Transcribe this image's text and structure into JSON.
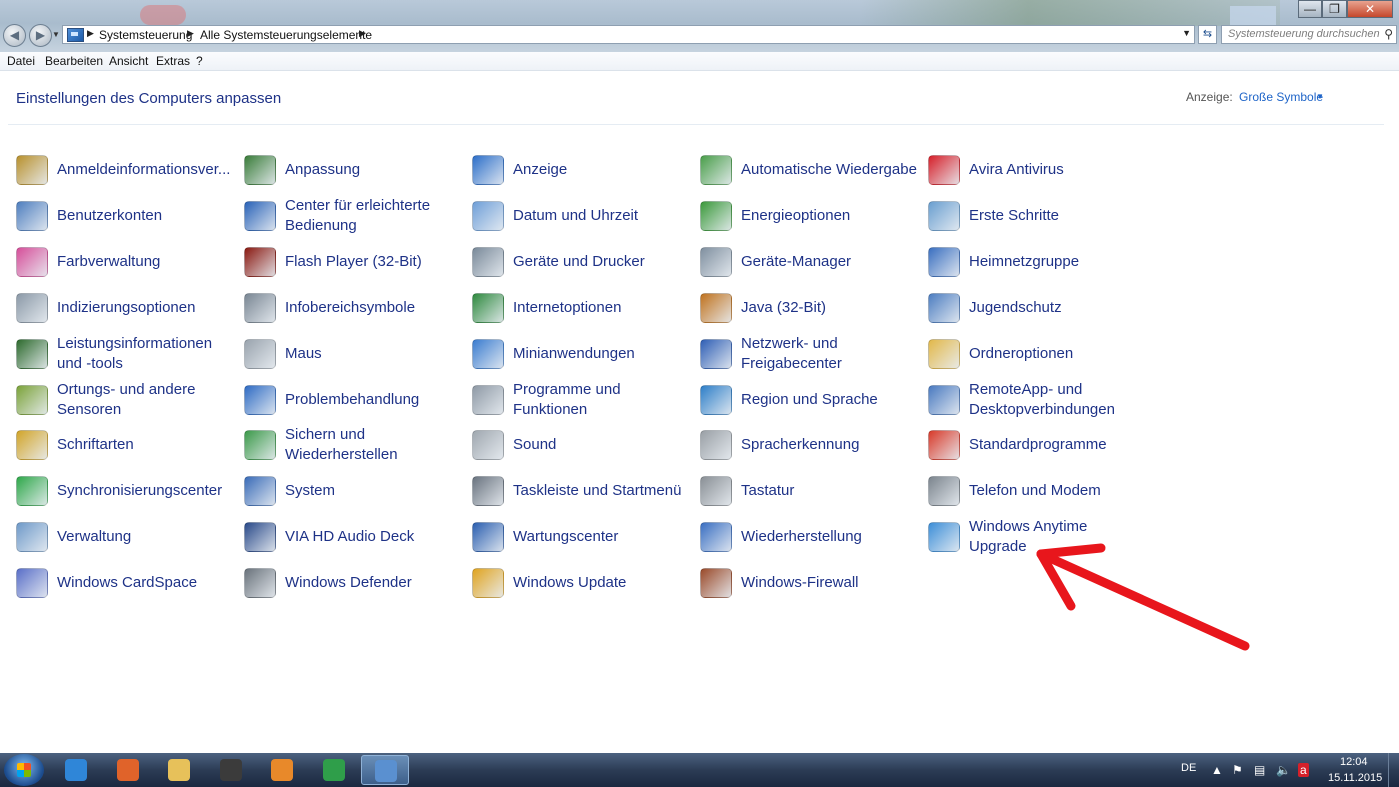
{
  "window": {
    "breadcrumb": [
      "Systemsteuerung",
      "Alle Systemsteuerungselemente"
    ],
    "search_placeholder": "Systemsteuerung durchsuchen",
    "close_color": "#c5472c"
  },
  "menubar": [
    "Datei",
    "Bearbeiten",
    "Ansicht",
    "Extras",
    "?"
  ],
  "content": {
    "title": "Einstellungen des Computers anpassen",
    "view_label": "Anzeige:",
    "view_value": "Große Symbole"
  },
  "items": [
    {
      "label": "Anmeldeinformationsver...",
      "icon": "credential-vault-icon",
      "color": "#b8912e"
    },
    {
      "label": "Anpassung",
      "icon": "personalization-icon",
      "color": "#3a7d3a"
    },
    {
      "label": "Anzeige",
      "icon": "display-icon",
      "color": "#2d6fc9"
    },
    {
      "label": "Automatische Wiedergabe",
      "icon": "autoplay-icon",
      "color": "#4a9e4a"
    },
    {
      "label": "Avira Antivirus",
      "icon": "avira-icon",
      "color": "#d6202a"
    },
    {
      "label": "Benutzerkonten",
      "icon": "user-accounts-icon",
      "color": "#4f7fbf"
    },
    {
      "label": "Center für erleichterte Bedienung",
      "icon": "ease-of-access-icon",
      "color": "#2a63b8"
    },
    {
      "label": "Datum und Uhrzeit",
      "icon": "date-time-icon",
      "color": "#6f9fd8"
    },
    {
      "label": "Energieoptionen",
      "icon": "power-options-icon",
      "color": "#3c9a3c"
    },
    {
      "label": "Erste Schritte",
      "icon": "getting-started-icon",
      "color": "#6a9fd0"
    },
    {
      "label": "Farbverwaltung",
      "icon": "color-management-icon",
      "color": "#d64f9a"
    },
    {
      "label": "Flash Player (32-Bit)",
      "icon": "flash-player-icon",
      "color": "#8a1a12"
    },
    {
      "label": "Geräte und Drucker",
      "icon": "devices-printers-icon",
      "color": "#7a8a9a"
    },
    {
      "label": "Geräte-Manager",
      "icon": "device-manager-icon",
      "color": "#8090a0"
    },
    {
      "label": "Heimnetzgruppe",
      "icon": "homegroup-icon",
      "color": "#3a6fc0"
    },
    {
      "label": "Indizierungsoptionen",
      "icon": "indexing-options-icon",
      "color": "#8c9aa8"
    },
    {
      "label": "Infobereichsymbole",
      "icon": "notification-icons-icon",
      "color": "#7a8794"
    },
    {
      "label": "Internetoptionen",
      "icon": "internet-options-icon",
      "color": "#2f8a3f"
    },
    {
      "label": "Java (32-Bit)",
      "icon": "java-icon",
      "color": "#c0731f"
    },
    {
      "label": "Jugendschutz",
      "icon": "parental-controls-icon",
      "color": "#4d7ec1"
    },
    {
      "label": "Leistungsinformationen und -tools",
      "icon": "performance-icon",
      "color": "#2e6b2e"
    },
    {
      "label": "Maus",
      "icon": "mouse-icon",
      "color": "#9aa4ae"
    },
    {
      "label": "Minianwendungen",
      "icon": "gadgets-icon",
      "color": "#3b7dd0"
    },
    {
      "label": "Netzwerk- und Freigabecenter",
      "icon": "network-sharing-icon",
      "color": "#2f5fb5"
    },
    {
      "label": "Ordneroptionen",
      "icon": "folder-options-icon",
      "color": "#e2b84a"
    },
    {
      "label": "Ortungs- und andere Sensoren",
      "icon": "sensors-icon",
      "color": "#7ca33a"
    },
    {
      "label": "Problembehandlung",
      "icon": "troubleshooting-icon",
      "color": "#2f6cc4"
    },
    {
      "label": "Programme und Funktionen",
      "icon": "programs-features-icon",
      "color": "#8f9aa6"
    },
    {
      "label": "Region und Sprache",
      "icon": "region-language-icon",
      "color": "#2e7fc8"
    },
    {
      "label": "RemoteApp- und Desktopverbindungen",
      "icon": "remoteapp-icon",
      "color": "#4a7ac0"
    },
    {
      "label": "Schriftarten",
      "icon": "fonts-icon",
      "color": "#d2a52a"
    },
    {
      "label": "Sichern und Wiederherstellen",
      "icon": "backup-restore-icon",
      "color": "#3c9a4a"
    },
    {
      "label": "Sound",
      "icon": "sound-icon",
      "color": "#a0a8b0"
    },
    {
      "label": "Spracherkennung",
      "icon": "speech-recognition-icon",
      "color": "#9aa0a6"
    },
    {
      "label": "Standardprogramme",
      "icon": "default-programs-icon",
      "color": "#d83a2a"
    },
    {
      "label": "Synchronisierungscenter",
      "icon": "sync-center-icon",
      "color": "#2fa84a"
    },
    {
      "label": "System",
      "icon": "system-icon",
      "color": "#3a6cb8"
    },
    {
      "label": "Taskleiste und Startmenü",
      "icon": "taskbar-start-icon",
      "color": "#6a7480"
    },
    {
      "label": "Tastatur",
      "icon": "keyboard-icon",
      "color": "#8a9096"
    },
    {
      "label": "Telefon und Modem",
      "icon": "phone-modem-icon",
      "color": "#7c858e"
    },
    {
      "label": "Verwaltung",
      "icon": "administrative-tools-icon",
      "color": "#6f9ac9"
    },
    {
      "label": "VIA HD Audio Deck",
      "icon": "via-audio-icon",
      "color": "#2a4a8a"
    },
    {
      "label": "Wartungscenter",
      "icon": "action-center-icon",
      "color": "#2b5fb0"
    },
    {
      "label": "Wiederherstellung",
      "icon": "recovery-icon",
      "color": "#3a6fc2"
    },
    {
      "label": "Windows Anytime Upgrade",
      "icon": "anytime-upgrade-icon",
      "color": "#3d8fd8"
    },
    {
      "label": "Windows CardSpace",
      "icon": "cardspace-icon",
      "color": "#5a6fc8"
    },
    {
      "label": "Windows Defender",
      "icon": "defender-icon",
      "color": "#6a737c"
    },
    {
      "label": "Windows Update",
      "icon": "windows-update-icon",
      "color": "#e0a420"
    },
    {
      "label": "Windows-Firewall",
      "icon": "firewall-icon",
      "color": "#9a4a2a"
    }
  ],
  "annotation": {
    "arrow_color": "#e8161c"
  },
  "taskbar": {
    "apps": [
      {
        "icon": "internet-explorer-icon",
        "color": "#2f86d8"
      },
      {
        "icon": "firefox-icon",
        "color": "#e0632a"
      },
      {
        "icon": "file-explorer-icon",
        "color": "#e7c15a"
      },
      {
        "icon": "video-editor-321-icon",
        "color": "#3b3b3b"
      },
      {
        "icon": "media-player-icon",
        "color": "#e8892a"
      },
      {
        "icon": "chrome-icon",
        "color": "#2f9e4a"
      },
      {
        "icon": "control-panel-icon",
        "color": "#5a90d0"
      }
    ],
    "language": "DE",
    "time": "12:04",
    "date": "15.11.2015"
  }
}
